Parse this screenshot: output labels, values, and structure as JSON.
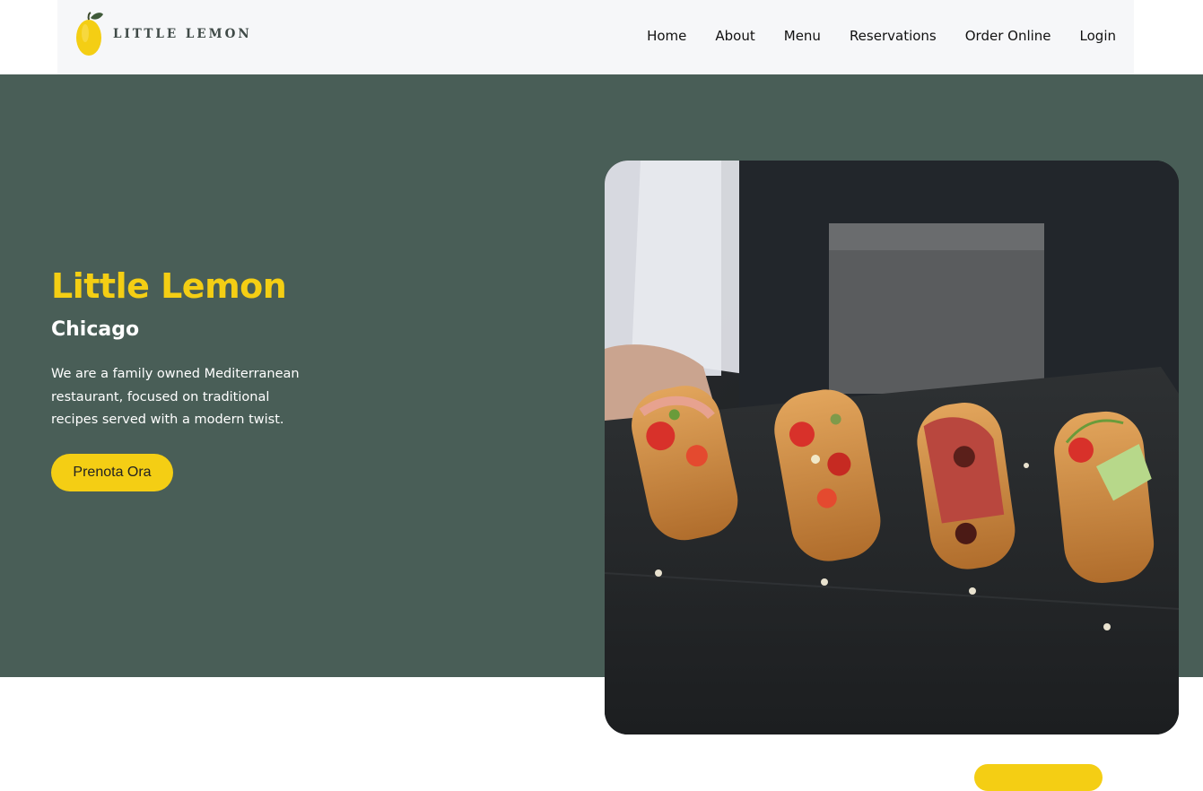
{
  "header": {
    "logo_text": "LITTLE LEMON",
    "logo_icon": "lemon-icon",
    "nav": [
      {
        "label": "Home"
      },
      {
        "label": "About"
      },
      {
        "label": "Menu"
      },
      {
        "label": "Reservations"
      },
      {
        "label": "Order Online"
      },
      {
        "label": "Login"
      }
    ]
  },
  "hero": {
    "title": "Little Lemon",
    "subtitle": "Chicago",
    "description": "We are a family owned Mediterranean restaurant, focused on traditional recipes served with a modern twist.",
    "cta_label": "Prenota Ora",
    "image_subject": "bruschetta-platter-image"
  },
  "colors": {
    "primary_green": "#495e57",
    "primary_yellow": "#f4ce14",
    "header_bg": "#f6f7f9",
    "text_dark": "#111111"
  }
}
